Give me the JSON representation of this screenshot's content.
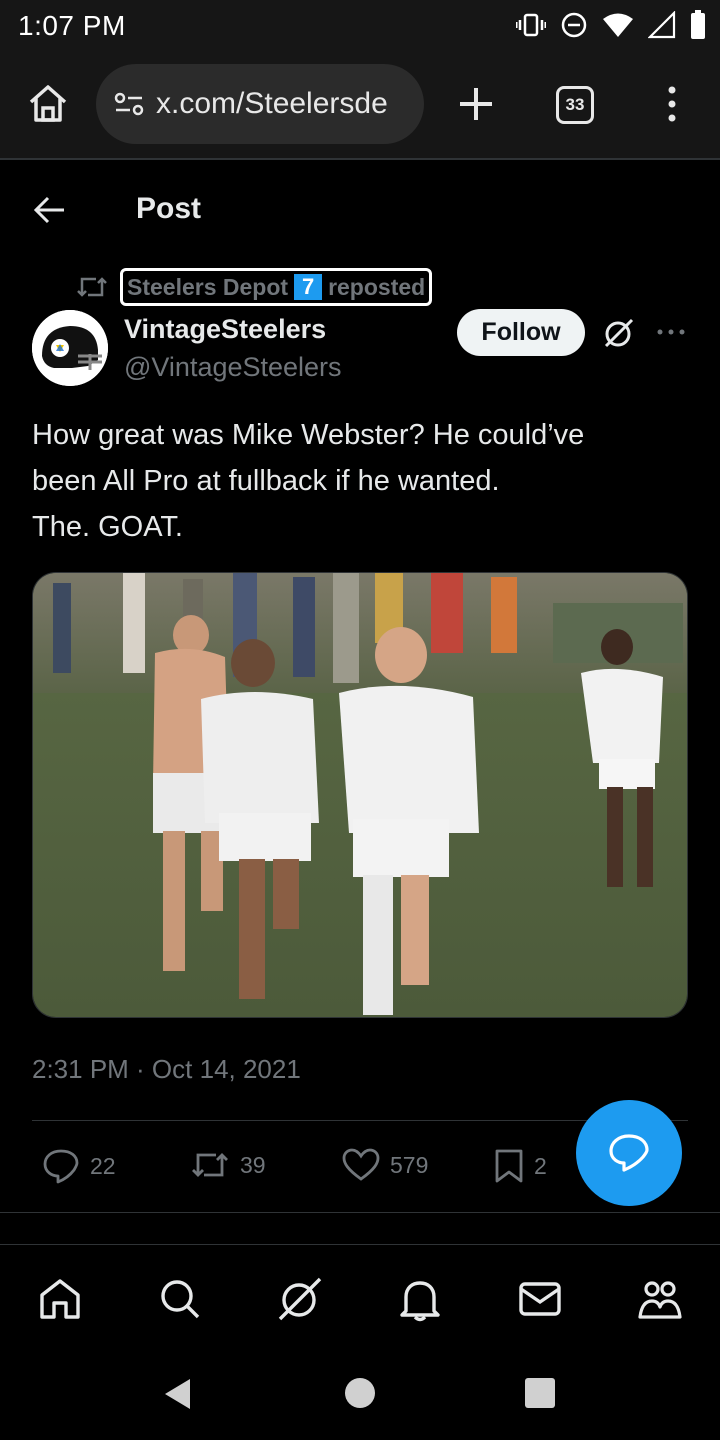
{
  "status_bar": {
    "time": "1:07 PM"
  },
  "browser": {
    "url": "x.com/Steelersde",
    "tab_count": "33"
  },
  "header": {
    "title": "Post"
  },
  "repost": {
    "reposter_name": "Steelers Depot",
    "reposter_badge": "7",
    "suffix": "reposted"
  },
  "post": {
    "author_name": "VintageSteelers",
    "author_handle": "@VintageSteelers",
    "follow_label": "Follow",
    "text_lines": [
      "How great was Mike Webster? He could’ve",
      "been All Pro at fullback if he wanted.",
      "The. GOAT."
    ],
    "timestamp": "2:31 PM · Oct 14, 2021",
    "stats": {
      "replies": "22",
      "reposts": "39",
      "likes": "579",
      "bookmarks": "2"
    }
  },
  "colors": {
    "accent": "#1d9bf0",
    "muted": "#71767b",
    "text": "#e7e9ea",
    "background": "#000000"
  },
  "nav_icons": [
    "home-icon",
    "search-icon",
    "grok-icon",
    "notifications-icon",
    "messages-icon",
    "communities-icon"
  ]
}
